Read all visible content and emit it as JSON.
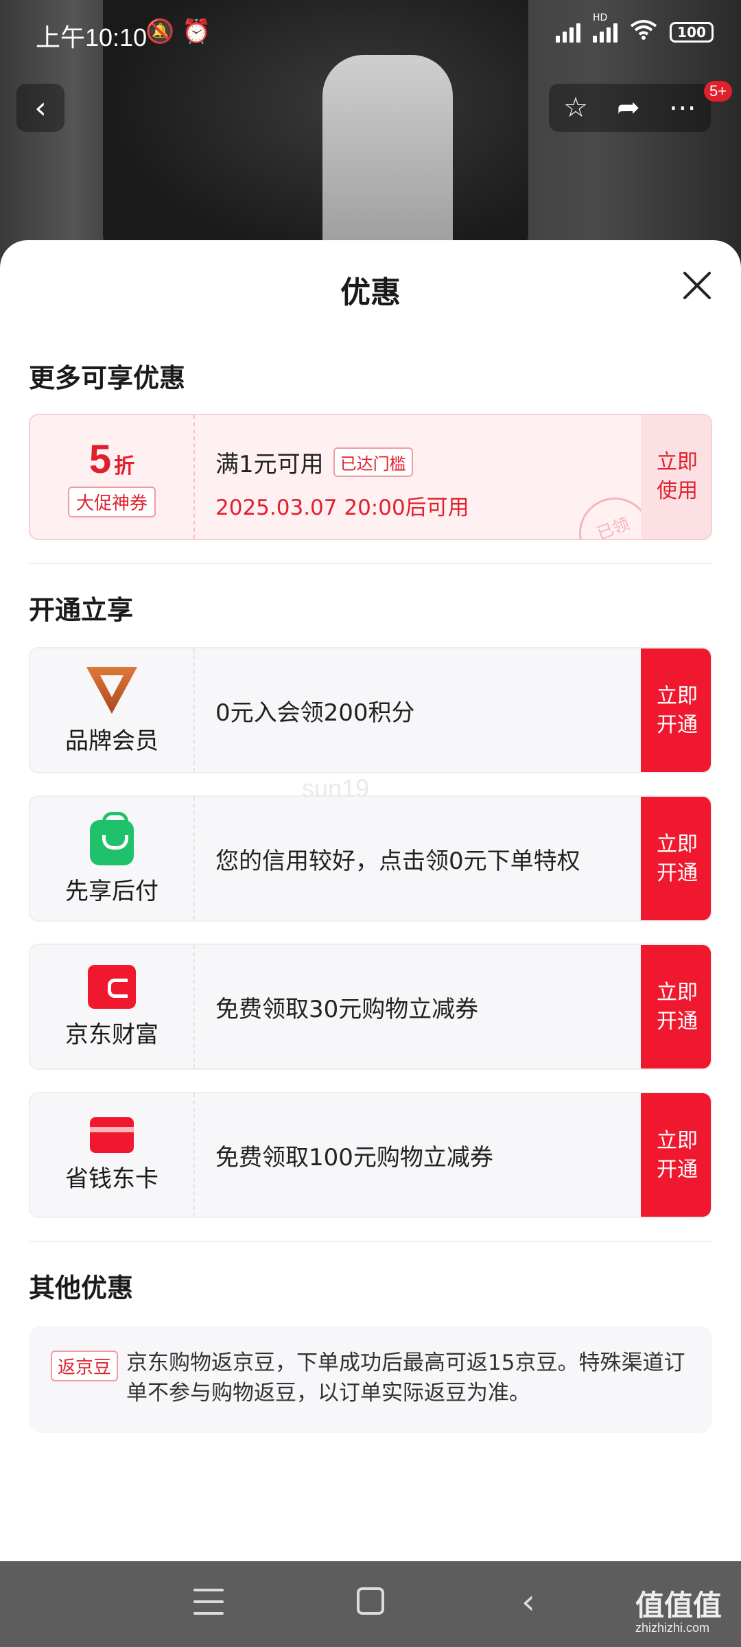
{
  "status_bar": {
    "time": "上午10:10",
    "battery": "100",
    "network_label": "HD"
  },
  "nav": {
    "back_icon": "back-arrow-icon",
    "badge": "5+"
  },
  "sheet": {
    "title": "优惠",
    "section_more": "更多可享优惠",
    "coupon": {
      "number": "5",
      "unit": "折",
      "tag": "大促神券",
      "condition": "满1元可用",
      "reached": "已达门槛",
      "date": "2025.03.07 20:00后可用",
      "button": "立即使用",
      "stamp": "已领"
    },
    "section_open": "开通立享",
    "benefits": [
      {
        "name": "品牌会员",
        "text": "0元入会领200积分",
        "button": "立即开通",
        "icon": "brand-v-icon"
      },
      {
        "name": "先享后付",
        "text": "您的信用较好，点击领0元下单特权",
        "button": "立即开通",
        "icon": "shopping-bag-icon"
      },
      {
        "name": "京东财富",
        "text": "免费领取30元购物立减券",
        "button": "立即开通",
        "icon": "wallet-icon"
      },
      {
        "name": "省钱东卡",
        "text": "免费领取100元购物立减券",
        "button": "立即开通",
        "icon": "card-icon"
      }
    ],
    "section_other": "其他优惠",
    "other": {
      "tag": "返京豆",
      "text": "京东购物返京豆，下单成功后最高可返15京豆。特殊渠道订单不参与购物返豆，以订单实际返豆为准。"
    }
  },
  "watermark": {
    "center": "sun19",
    "brand": "值值值",
    "site": "zhizhizhi.com"
  }
}
